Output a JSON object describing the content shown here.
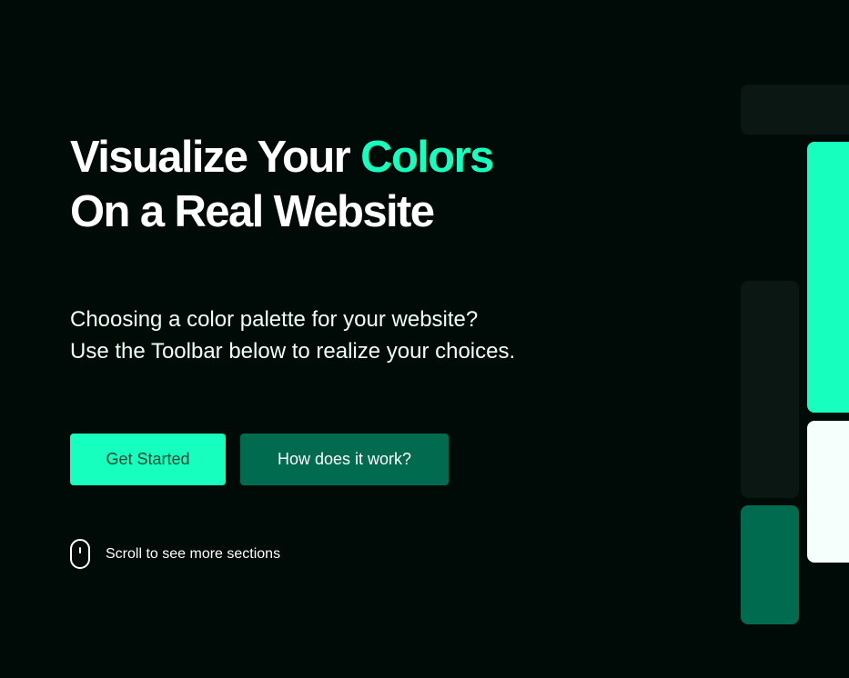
{
  "hero": {
    "title_line1_prefix": "Visualize Your ",
    "title_line1_accent": "Colors",
    "title_line2": "On a Real Website",
    "subtitle_line1": "Choosing a color palette for your website?",
    "subtitle_line2": "Use the Toolbar below to realize your choices."
  },
  "buttons": {
    "primary_label": "Get Started",
    "secondary_label": "How does it work?"
  },
  "scroll_hint": {
    "icon": "mouse-icon",
    "text": "Scroll to see more sections"
  },
  "palette": {
    "background": "#000a06",
    "text": "#ffffff",
    "primary": "#16ffbf",
    "secondary": "#006b4f",
    "surface": "#0b1712",
    "light": "#f5fffb"
  }
}
